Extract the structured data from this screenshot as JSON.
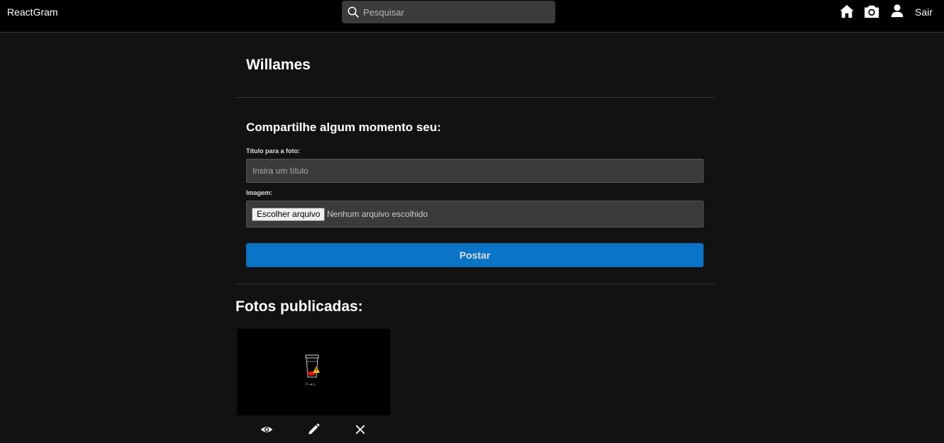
{
  "navbar": {
    "brand": "ReactGram",
    "search_placeholder": "Pesquisar",
    "icons": [
      "home-icon",
      "camera-icon",
      "user-icon"
    ],
    "logout_label": "Sair"
  },
  "profile": {
    "name": "Willames"
  },
  "new_photo_form": {
    "title": "Compartilhe algum momento seu:",
    "title_label": "Título para a foto:",
    "title_placeholder": "Insira um título",
    "title_value": "",
    "image_label": "Imagem:",
    "file_button_label": "Escolher arquivo",
    "file_status": "Nenhum arquivo escolhido",
    "submit_label": "Postar"
  },
  "photos": {
    "title": "Fotos publicadas:",
    "items": [
      {
        "actions": [
          "eye-icon",
          "pencil-icon",
          "close-icon"
        ]
      }
    ]
  },
  "colors": {
    "background": "#121212",
    "navbar": "#000000",
    "input": "#3b3b3b",
    "primary": "#0a74c7"
  }
}
